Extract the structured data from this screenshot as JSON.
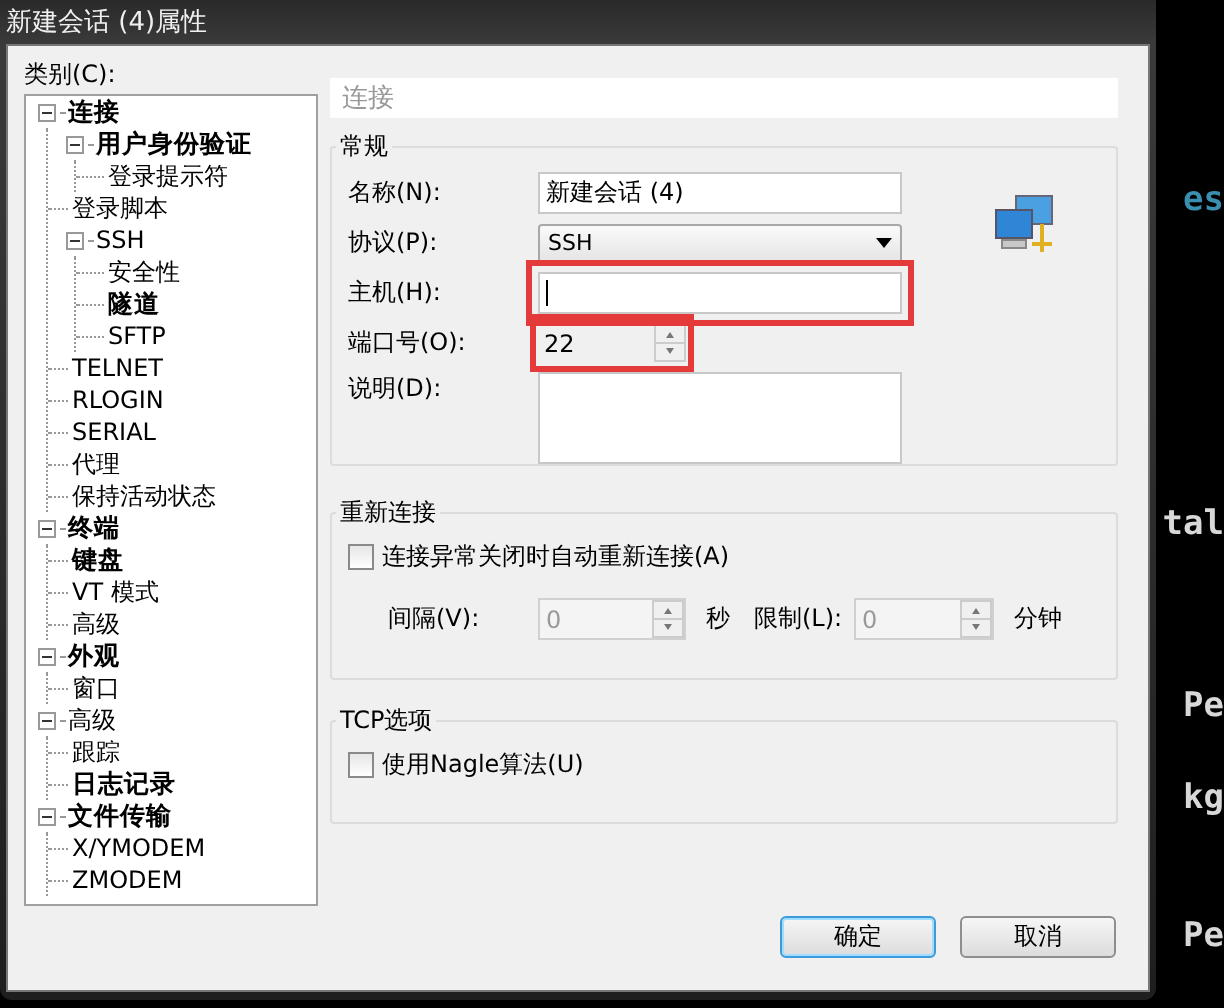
{
  "window": {
    "title": "新建会话 (4)属性"
  },
  "category_label": "类别(C):",
  "tree": [
    {
      "label": "连接",
      "bold": true,
      "expanded": true,
      "children": [
        {
          "label": "用户身份验证",
          "bold": true,
          "expanded": true,
          "children": [
            {
              "label": "登录提示符",
              "bold": false
            }
          ]
        },
        {
          "label": "登录脚本",
          "bold": false
        },
        {
          "label": "SSH",
          "bold": false,
          "expanded": true,
          "children": [
            {
              "label": "安全性",
              "bold": false
            },
            {
              "label": "隧道",
              "bold": true
            },
            {
              "label": "SFTP",
              "bold": false
            }
          ]
        },
        {
          "label": "TELNET",
          "bold": false
        },
        {
          "label": "RLOGIN",
          "bold": false
        },
        {
          "label": "SERIAL",
          "bold": false
        },
        {
          "label": "代理",
          "bold": false
        },
        {
          "label": "保持活动状态",
          "bold": false
        }
      ]
    },
    {
      "label": "终端",
      "bold": true,
      "expanded": true,
      "children": [
        {
          "label": "键盘",
          "bold": true
        },
        {
          "label": "VT 模式",
          "bold": false
        },
        {
          "label": "高级",
          "bold": false
        }
      ]
    },
    {
      "label": "外观",
      "bold": true,
      "expanded": true,
      "children": [
        {
          "label": "窗口",
          "bold": false
        }
      ]
    },
    {
      "label": "高级",
      "bold": false,
      "expanded": true,
      "children": [
        {
          "label": "跟踪",
          "bold": false
        },
        {
          "label": "日志记录",
          "bold": true
        }
      ]
    },
    {
      "label": "文件传输",
      "bold": true,
      "expanded": true,
      "children": [
        {
          "label": "X/YMODEM",
          "bold": false
        },
        {
          "label": "ZMODEM",
          "bold": false
        }
      ]
    }
  ],
  "panel_title": "连接",
  "general": {
    "title": "常规",
    "name": {
      "label": "名称(N):",
      "value": "新建会话 (4)"
    },
    "protocol": {
      "label": "协议(P):",
      "value": "SSH"
    },
    "host": {
      "label": "主机(H):",
      "highlighted": true
    },
    "port": {
      "label": "端口号(O):",
      "value": "22",
      "highlighted": true
    },
    "description": {
      "label": "说明(D):"
    }
  },
  "reconnect": {
    "title": "重新连接",
    "checkbox": {
      "label": "连接异常关闭时自动重新连接(A)",
      "checked": false
    },
    "interval": {
      "label": "间隔(V):",
      "value": "0",
      "unit": "秒",
      "disabled": true
    },
    "limit": {
      "label": "限制(L):",
      "value": "0",
      "unit": "分钟",
      "disabled": true
    }
  },
  "tcp": {
    "title": "TCP选项",
    "checkbox": {
      "label": "使用Nagle算法(U)",
      "checked": false
    }
  },
  "buttons": [
    {
      "label": "确定",
      "default": true
    },
    {
      "label": "取消",
      "default": false
    }
  ],
  "terminal_fragments": [
    {
      "text": "es",
      "color": "#3a8fb0"
    },
    {
      "text": "tal",
      "color": "#d8d8d8"
    },
    {
      "text": "Pe",
      "color": "#d8d8d8"
    },
    {
      "text": "kg",
      "color": "#d8d8d8"
    },
    {
      "text": "Pe",
      "color": "#d8d8d8"
    }
  ]
}
